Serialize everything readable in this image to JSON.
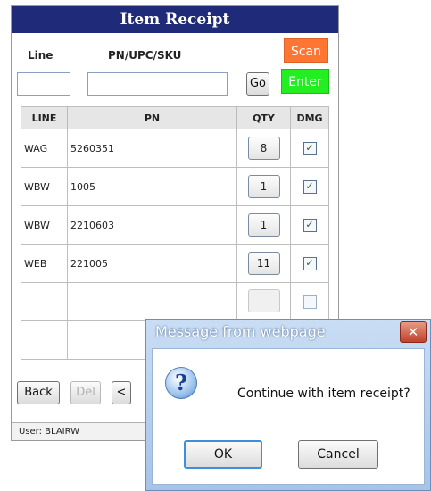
{
  "app": {
    "title": "Item Receipt",
    "line_label": "Line",
    "pn_label": "PN/UPC/SKU",
    "line_value": "",
    "pn_value": "",
    "go_label": "Go",
    "scan_label": "Scan",
    "enter_label": "Enter",
    "columns": [
      "LINE",
      "PN",
      "QTY",
      "DMG"
    ],
    "rows": [
      {
        "line": "WAG",
        "pn": "5260351",
        "qty": "8",
        "dmg": true
      },
      {
        "line": "WBW",
        "pn": "1005",
        "qty": "1",
        "dmg": true
      },
      {
        "line": "WBW",
        "pn": "2210603",
        "qty": "1",
        "dmg": true
      },
      {
        "line": "WEB",
        "pn": "221005",
        "qty": "11",
        "dmg": true
      },
      {
        "line": "",
        "pn": "",
        "qty": "",
        "dmg": false
      },
      {
        "line": "",
        "pn": "",
        "qty": "",
        "dmg": false
      }
    ],
    "nav": {
      "back": "Back",
      "del": "Del",
      "prev": "<"
    },
    "status": "User: BLAIRW"
  },
  "dialog": {
    "title": "Message from webpage",
    "close": "✕",
    "icon": "question-icon",
    "icon_glyph": "?",
    "message": "Continue with item receipt?",
    "ok": "OK",
    "cancel": "Cancel"
  },
  "colors": {
    "title_bar": "#1f2a78",
    "scan": "#ff7633",
    "enter": "#22ee22"
  }
}
